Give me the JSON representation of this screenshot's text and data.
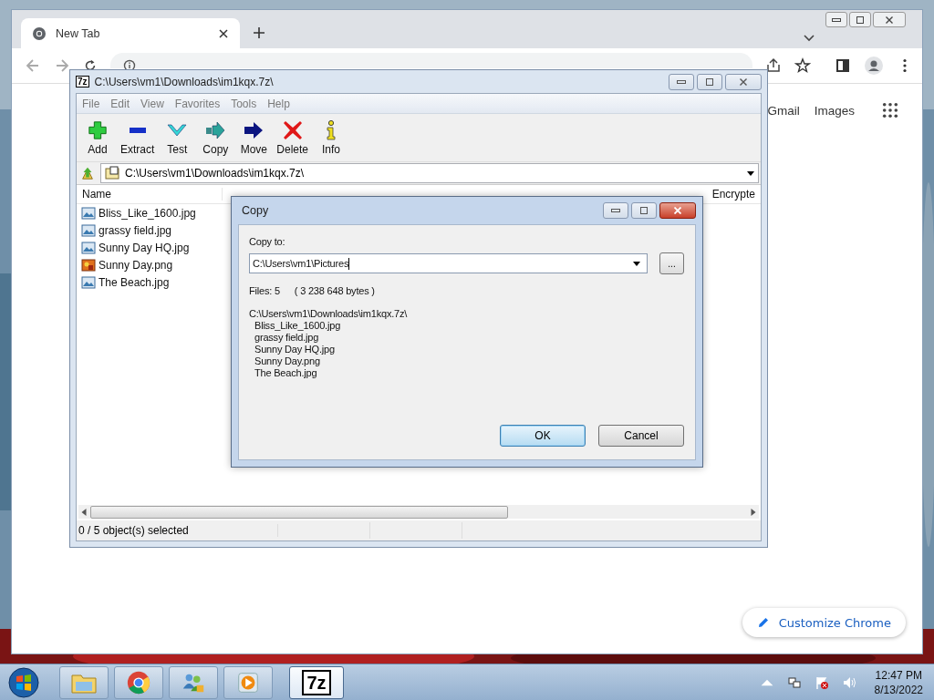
{
  "browser": {
    "tabs": [
      {
        "title": "New Tab",
        "selected": true
      }
    ],
    "links": [
      "Gmail",
      "Images"
    ],
    "customize_button": "Customize Chrome"
  },
  "archive_window": {
    "icon_text": "7z",
    "title": "C:\\Users\\vm1\\Downloads\\im1kqx.7z\\",
    "menu": [
      "File",
      "Edit",
      "View",
      "Favorites",
      "Tools",
      "Help"
    ],
    "toolbar": [
      {
        "label": "Add",
        "kind": "add"
      },
      {
        "label": "Extract",
        "kind": "extract"
      },
      {
        "label": "Test",
        "kind": "test"
      },
      {
        "label": "Copy",
        "kind": "copy"
      },
      {
        "label": "Move",
        "kind": "move"
      },
      {
        "label": "Delete",
        "kind": "delete"
      },
      {
        "label": "Info",
        "kind": "info"
      }
    ],
    "path": "C:\\Users\\vm1\\Downloads\\im1kqx.7z\\",
    "columns": [
      "Name",
      "Encrypte"
    ],
    "rows": [
      {
        "name": "Bliss_Like_1600.jpg",
        "kind": "jpg"
      },
      {
        "name": "grassy field.jpg",
        "kind": "jpg"
      },
      {
        "name": "Sunny Day HQ.jpg",
        "kind": "jpg"
      },
      {
        "name": "Sunny Day.png",
        "kind": "png"
      },
      {
        "name": "The Beach.jpg",
        "kind": "jpg"
      }
    ],
    "status": "0 / 5 object(s) selected"
  },
  "copy_dialog": {
    "title": "Copy",
    "label": "Copy to:",
    "value": "C:\\Users\\vm1\\Pictures",
    "browse": "...",
    "files_count": "Files: 5",
    "size": "( 3 238 648 bytes )",
    "source": "C:\\Users\\vm1\\Downloads\\im1kqx.7z\\",
    "files": [
      "Bliss_Like_1600.jpg",
      "grassy field.jpg",
      "Sunny Day HQ.jpg",
      "Sunny Day.png",
      "The Beach.jpg"
    ],
    "buttons": [
      {
        "label": "OK",
        "default": true
      },
      {
        "label": "Cancel",
        "default": false
      }
    ]
  },
  "taskbar": {
    "apps": [
      {
        "kind": "explorer",
        "active": false
      },
      {
        "kind": "chrome",
        "active": false
      },
      {
        "kind": "users",
        "active": false
      },
      {
        "kind": "media",
        "active": false
      },
      {
        "kind": "sevenzip",
        "active": true,
        "icon_text": "7z"
      }
    ],
    "time": "12:47 PM",
    "date": "8/13/2022"
  }
}
